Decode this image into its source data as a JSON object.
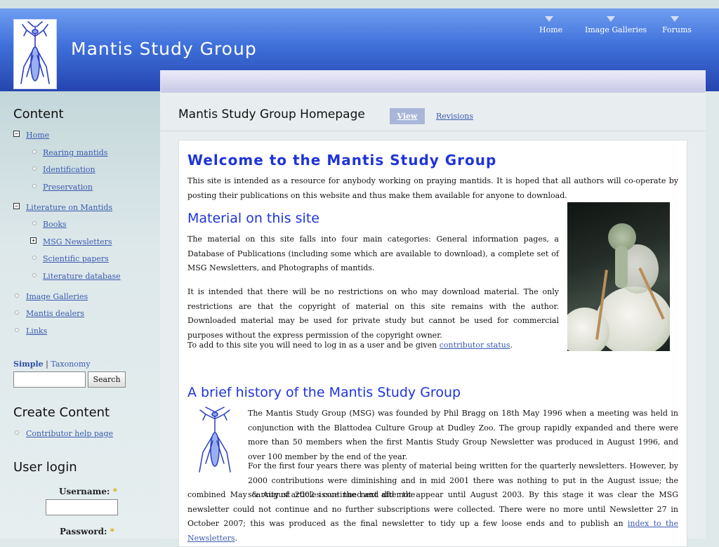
{
  "header": {
    "site_name": "Mantis Study Group",
    "logo_icon": "mantis-logo-icon",
    "nav": [
      {
        "label": "Home"
      },
      {
        "label": "Image Galleries"
      },
      {
        "label": "Forums"
      }
    ]
  },
  "sidebar": {
    "content_title": "Content",
    "menu": {
      "home": "Home",
      "rearing": "Rearing mantids",
      "identification": "Identification",
      "preservation": "Preservation",
      "literature": "Literature on Mantids",
      "books": "Books",
      "newsletters": "MSG Newsletters",
      "scientific": "Scientific papers",
      "lit_db": "Literature database",
      "galleries": "Image Galleries",
      "dealers": "Mantis dealers",
      "links": "Links"
    },
    "search": {
      "tab_simple": "Simple",
      "separator": "|",
      "tab_taxonomy": "Taxonomy",
      "input_value": "",
      "button": "Search"
    },
    "create_title": "Create Content",
    "create_items": {
      "help": "Contributor help page"
    },
    "login_title": "User login",
    "login": {
      "username_label": "Username:",
      "password_label": "Password:",
      "required_mark": "*"
    }
  },
  "main": {
    "page_title": "Mantis Study Group Homepage",
    "tabs": {
      "view": "View",
      "revisions": "Revisions"
    },
    "article": {
      "welcome_heading": "Welcome to the Mantis Study Group",
      "intro": "This site is intended as a resource for anybody working on praying mantids.  It is hoped that all authors will co-operate by posting their publications on this website and thus make them available for anyone to download.",
      "material_heading": "Material on this site",
      "material_p1": "The material on this site falls into four main categories: General information pages, a Database of Publications (including some which are available to download), a complete set of MSG Newsletters, and Photographs of mantids.",
      "material_p2": "It is intended that there will be no restrictions on who may download material.  The only restrictions are that the copyright of material on this site remains with the author.  Downloaded material may be used for private study but cannot be used for commercial purposes without the express permission of the copyright owner.",
      "material_p3_before": "To add to this site you will need to log in as a user and be given ",
      "material_p3_link": "contributor status",
      "material_p3_after": ".",
      "history_heading": "A brief history of the Mantis Study Group",
      "history_p1": "The Mantis Study Group (MSG) was founded by Phil Bragg on 18th May 1996 when a meeting was held in conjunction with the Blattodea Culture Group at Dudley Zoo.  The group rapidly expanded and there were more than 50 members when the first Mantis Study Group Newsletter was produced in August 1996, and over 100 member by the end of the year.",
      "history_p2a": "For the first four years there was plenty of material being written for the quarterly newsletters.  However, by 2000 contributions were diminishing and in mid 2001 there was nothing to put in the August issue; the scarcity of articles continued and after the",
      "history_p2b": "combined May & August 2002 issue the next did not appear until August 2003.  By this stage it was clear the MSG newsletter could not continue and no further subscriptions were collected.  There were no more until Newsletter 27 in October 2007; this was produced as the final newsletter to tidy up a few loose ends and to publish an ",
      "history_p2_link": "index to the Newsletters",
      "history_p2_after": "."
    }
  },
  "colors": {
    "header_top": "#6f9ef0",
    "header_bottom": "#2545b0",
    "heading_blue": "#1e34d8",
    "link_blue": "#3b5bb0",
    "tab_active": "#a9b6d9"
  }
}
